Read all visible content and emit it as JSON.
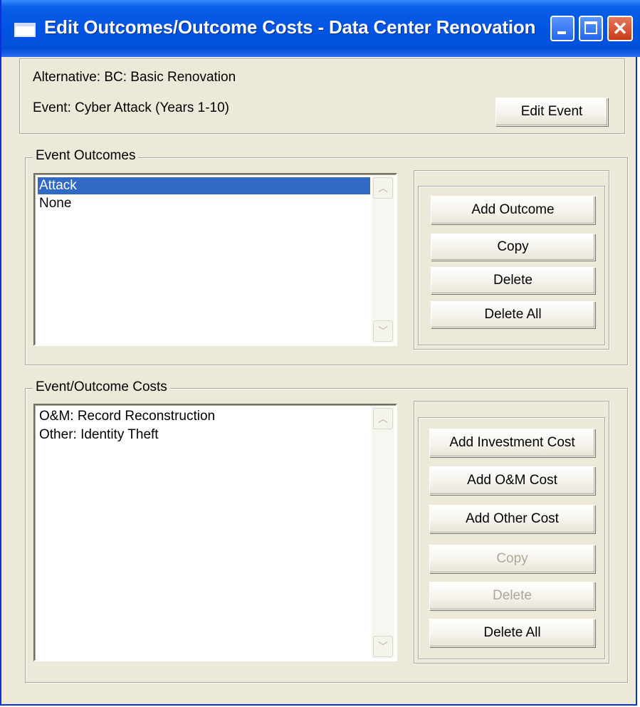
{
  "window": {
    "title": "Edit Outcomes/Outcome Costs - Data Center Renovation",
    "close_glyph": "✕"
  },
  "header": {
    "alternative_label": "Alternative:  BC: Basic Renovation",
    "event_label": "Event:  Cyber Attack (Years 1-10)",
    "edit_event_button": "Edit Event"
  },
  "outcomes": {
    "group_label": "Event Outcomes",
    "items": [
      {
        "label": "Attack",
        "selected": true
      },
      {
        "label": "None",
        "selected": false
      }
    ],
    "buttons": {
      "add": "Add Outcome",
      "copy": "Copy",
      "delete": "Delete",
      "delete_all": "Delete All"
    }
  },
  "costs": {
    "group_label": "Event/Outcome Costs",
    "items": [
      {
        "label": "O&M: Record Reconstruction"
      },
      {
        "label": "Other: Identity Theft"
      }
    ],
    "buttons": {
      "add_investment": "Add Investment Cost",
      "add_om": "Add O&M Cost",
      "add_other": "Add Other Cost",
      "copy": "Copy",
      "delete": "Delete",
      "delete_all": "Delete All"
    }
  },
  "scroll_glyphs": {
    "up": "︿",
    "down": "﹀"
  },
  "colors": {
    "title_bar": "#0054e3",
    "selection": "#316ac5",
    "dialog_bg": "#ece9d8"
  }
}
